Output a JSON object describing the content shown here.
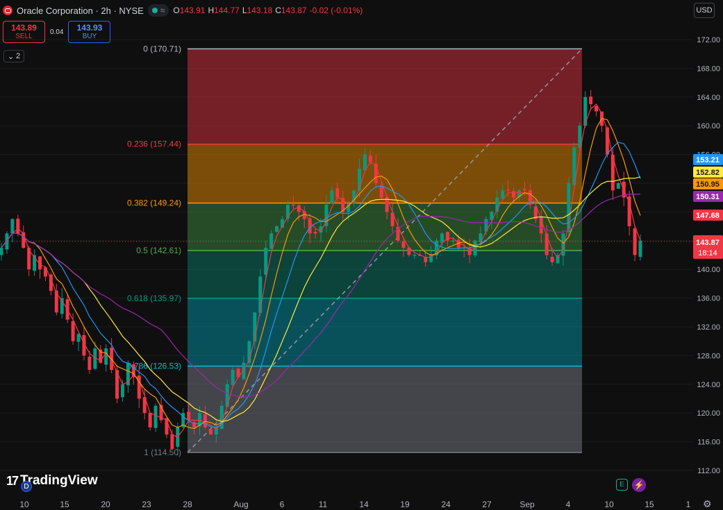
{
  "header": {
    "title": "Oracle Corporation · 2h · NYSE",
    "ohlc": [
      {
        "k": "O",
        "v": "143.91"
      },
      {
        "k": "H",
        "v": "144.77"
      },
      {
        "k": "L",
        "v": "143.18"
      },
      {
        "k": "C",
        "v": "143.87"
      }
    ],
    "change": "-0.02 (-0.01%)"
  },
  "trade": {
    "sell_price": "143.89",
    "sell_label": "SELL",
    "spread": "0.04",
    "buy_price": "143.93",
    "buy_label": "BUY"
  },
  "indicators_count": "2",
  "currency": "USD",
  "brand": "TradingView",
  "badges": {
    "d": "D",
    "e": "E"
  },
  "colors": {
    "up": "#089981",
    "down": "#f23645",
    "ma_red": "#f23645",
    "ma_orange": "#ff9800",
    "ma_blue": "#2196f3",
    "ma_yellow": "#ffeb3b",
    "ma_purple": "#9c27b0"
  },
  "chart_data": {
    "type": "candlestick",
    "title": "Oracle Corporation · 2h · NYSE",
    "ylim": [
      110,
      174
    ],
    "y_ticks": [
      112,
      116,
      120,
      124,
      128,
      132,
      136,
      140,
      144,
      148,
      152,
      156,
      160,
      164,
      168,
      172
    ],
    "x_ticks": [
      "10",
      "15",
      "20",
      "23",
      "28",
      "Aug",
      "6",
      "11",
      "14",
      "19",
      "24",
      "27",
      "Sep",
      "4",
      "10",
      "15",
      "1"
    ],
    "last_price": {
      "value": 143.87,
      "label": "143.87",
      "countdown": "18:14"
    },
    "price_tags": [
      {
        "value": 153.21,
        "label": "153.21",
        "color": "#2196f3"
      },
      {
        "value": 152.82,
        "label": "152.82",
        "color": "#ffeb3b"
      },
      {
        "value": 150.95,
        "label": "150.95",
        "color": "#ff9800"
      },
      {
        "value": 150.31,
        "label": "150.31",
        "color": "#9c27b0"
      },
      {
        "value": 147.68,
        "label": "147.68",
        "color": "#f23645"
      }
    ],
    "fibonacci": {
      "high": 170.71,
      "low": 114.5,
      "levels": [
        {
          "ratio": "0",
          "price": 170.71,
          "label": "0 (170.71)",
          "color": "#b2b5be",
          "fill": "rgba(242,54,69,0.45)"
        },
        {
          "ratio": "0.236",
          "price": 157.44,
          "label": "0.236 (157.44)",
          "color": "#f23645",
          "fill": "rgba(255,152,0,0.45)"
        },
        {
          "ratio": "0.382",
          "price": 149.24,
          "label": "0.382 (149.24)",
          "color": "#ff9800",
          "fill": "rgba(76,175,80,0.38)"
        },
        {
          "ratio": "0.5",
          "price": 142.61,
          "label": "0.5 (142.61)",
          "color": "#4caf50",
          "fill": "rgba(8,153,129,0.38)"
        },
        {
          "ratio": "0.618",
          "price": 135.97,
          "label": "0.618 (135.97)",
          "color": "#089981",
          "fill": "rgba(0,188,212,0.38)"
        },
        {
          "ratio": "0.786",
          "price": 126.53,
          "label": "0.786 (126.53)",
          "color": "#00bcd4",
          "fill": "rgba(120,123,134,0.5)"
        },
        {
          "ratio": "1",
          "price": 114.5,
          "label": "1 (114.50)",
          "color": "#787b86",
          "fill": null
        }
      ]
    },
    "candles_close": [
      143,
      145,
      147,
      145,
      143,
      140,
      142,
      140,
      139,
      137,
      134,
      136,
      133,
      130,
      131,
      128,
      126,
      129,
      127,
      129,
      126,
      122,
      124,
      127,
      125,
      122,
      120,
      118,
      121,
      119,
      117,
      115,
      118,
      120,
      119,
      118,
      120,
      118,
      117,
      118,
      121,
      124,
      126,
      125,
      127,
      130,
      134,
      139,
      143,
      145,
      146,
      147,
      149,
      149,
      148,
      147,
      145,
      145,
      146,
      149,
      151,
      150,
      148,
      149,
      151,
      154,
      156,
      155,
      152,
      150,
      148,
      146,
      144,
      143,
      142,
      142,
      142,
      141,
      142,
      144,
      145,
      144,
      144,
      143,
      143,
      142,
      144,
      145,
      147,
      148,
      150,
      151,
      151,
      150,
      151,
      151,
      149,
      147,
      145,
      142,
      141,
      142,
      145,
      152,
      157,
      160,
      164,
      163,
      162,
      160,
      156,
      151,
      152,
      150,
      146,
      142,
      144
    ]
  }
}
